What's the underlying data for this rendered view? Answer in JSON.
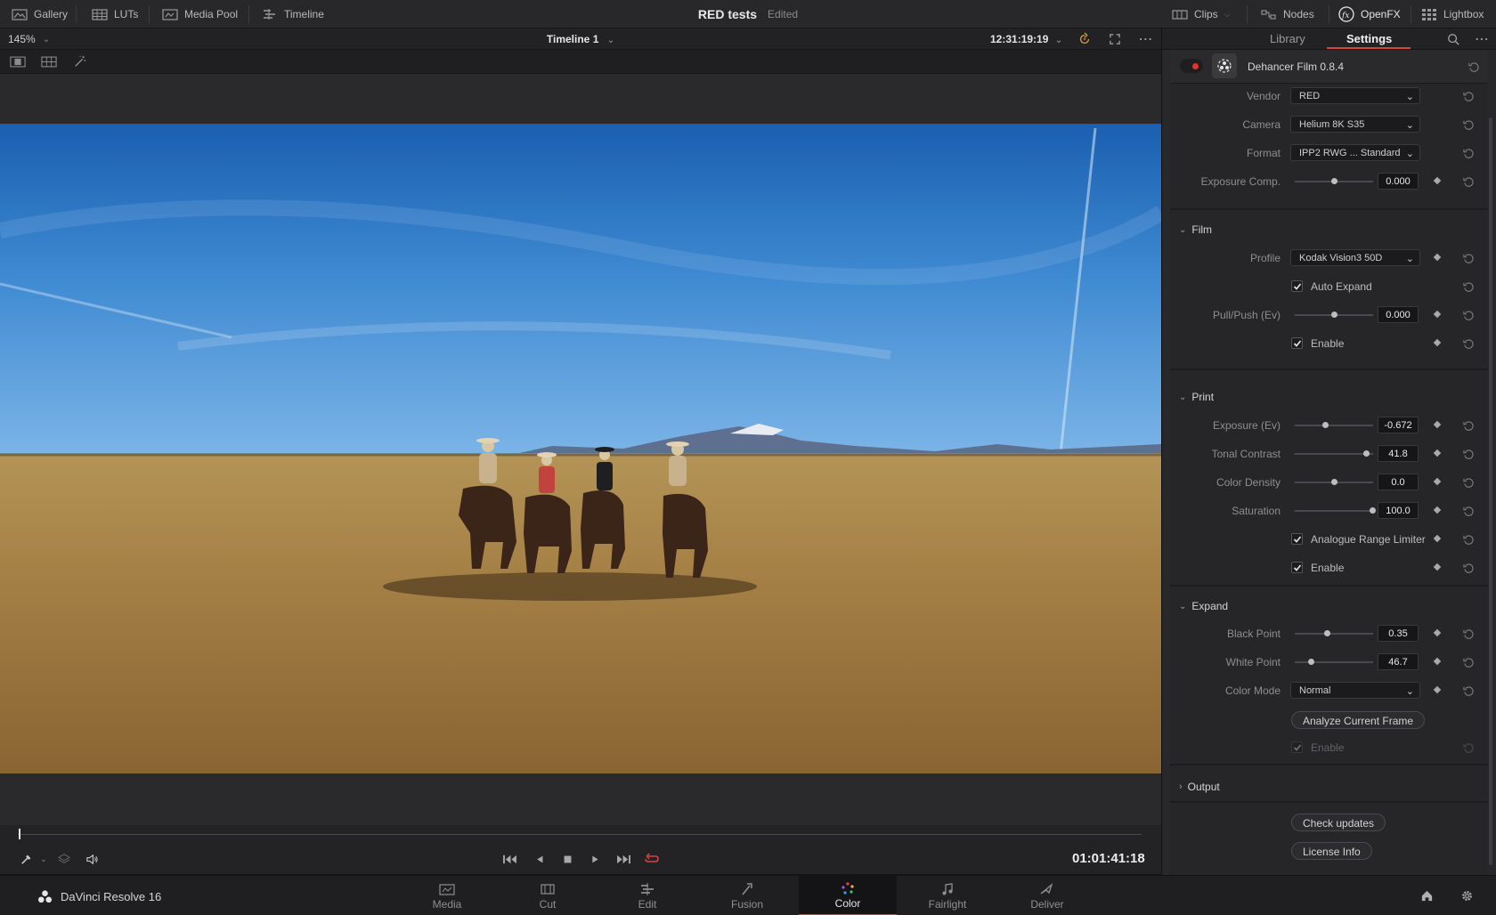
{
  "topbar": {
    "left_items": [
      {
        "label": "Gallery",
        "icon": "gallery-icon"
      },
      {
        "label": "LUTs",
        "icon": "luts-icon"
      },
      {
        "label": "Media Pool",
        "icon": "media-pool-icon"
      },
      {
        "label": "Timeline",
        "icon": "timeline-icon"
      }
    ],
    "project_name": "RED tests",
    "project_status": "Edited",
    "right_items": [
      {
        "label": "Clips",
        "icon": "clips-icon"
      },
      {
        "label": "Nodes",
        "icon": "nodes-icon"
      },
      {
        "label": "OpenFX",
        "icon": "fx-icon"
      },
      {
        "label": "Lightbox",
        "icon": "lightbox-icon"
      }
    ]
  },
  "viewer": {
    "zoom": "145%",
    "timeline_name": "Timeline 1",
    "timecode": "12:31:19:19",
    "playhead_timecode": "01:01:41:18"
  },
  "inspector": {
    "tabs": [
      "Library",
      "Settings"
    ],
    "active_tab": "Settings",
    "plugin_name": "Dehancer Film 0.8.4",
    "camera_section": {
      "vendor_label": "Vendor",
      "vendor": "RED",
      "camera_label": "Camera",
      "camera": "Helium 8K S35",
      "format_label": "Format",
      "format": "IPP2 RWG ... Standard",
      "exposure_comp_label": "Exposure Comp.",
      "exposure_comp": "0.000"
    },
    "film": {
      "title": "Film",
      "profile_label": "Profile",
      "profile": "Kodak Vision3 50D",
      "auto_expand": "Auto Expand",
      "pull_push_label": "Pull/Push (Ev)",
      "pull_push": "0.000",
      "enable": "Enable"
    },
    "print": {
      "title": "Print",
      "exposure_label": "Exposure (Ev)",
      "exposure": "-0.672",
      "tonal_contrast_label": "Tonal Contrast",
      "tonal_contrast": "41.8",
      "color_density_label": "Color Density",
      "color_density": "0.0",
      "saturation_label": "Saturation",
      "saturation": "100.0",
      "analogue_range_limiter": "Analogue Range Limiter",
      "enable": "Enable"
    },
    "expand": {
      "title": "Expand",
      "black_point_label": "Black Point",
      "black_point": "0.35",
      "white_point_label": "White Point",
      "white_point": "46.7",
      "color_mode_label": "Color Mode",
      "color_mode": "Normal",
      "analyze_button": "Analyze Current Frame",
      "enable": "Enable"
    },
    "output": {
      "title": "Output"
    },
    "check_updates_button": "Check updates",
    "license_info_button": "License Info"
  },
  "pagebar": {
    "app_name": "DaVinci Resolve 16",
    "pages": [
      "Media",
      "Cut",
      "Edit",
      "Fusion",
      "Color",
      "Fairlight",
      "Deliver"
    ],
    "active_page": "Color"
  },
  "colors": {
    "accent": "#d8433b",
    "record_dot": "#e1342c",
    "background": "#1c1c1e"
  }
}
